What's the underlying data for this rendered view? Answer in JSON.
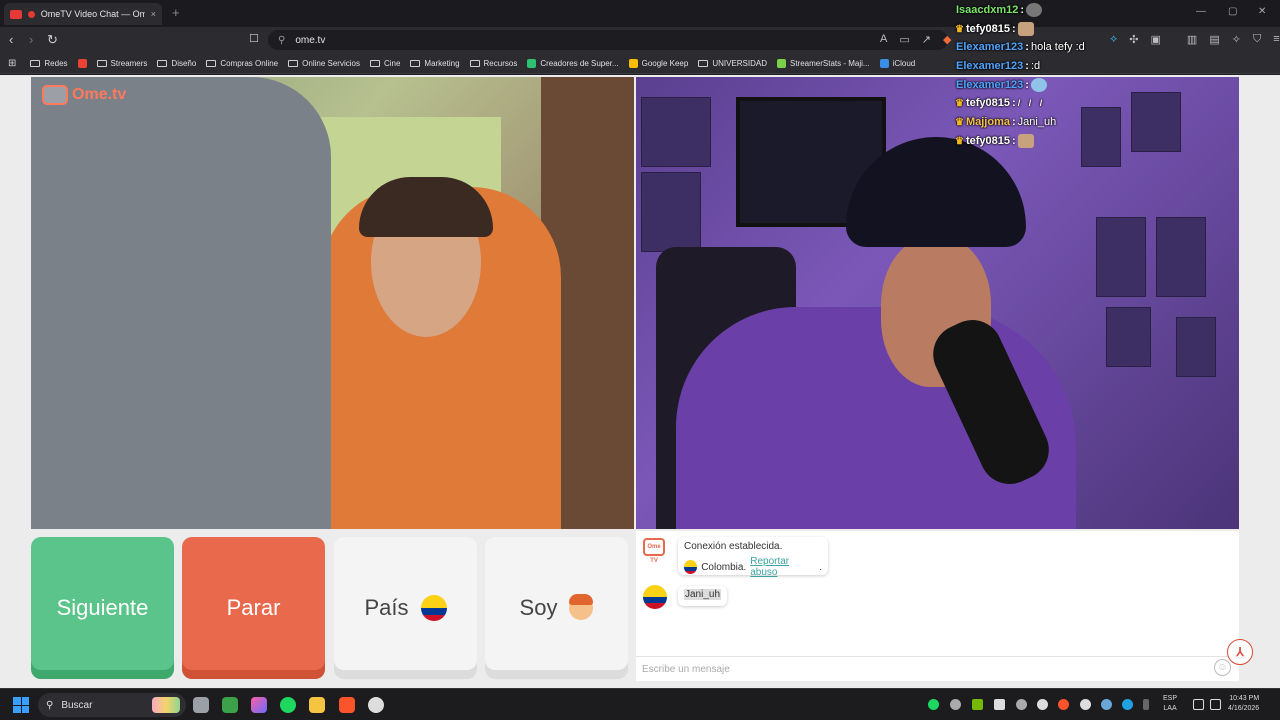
{
  "browser": {
    "tab_title": "OmeTV Video Chat — Omeg",
    "tab_close": "×",
    "new_tab": "+",
    "url": "ome.tv",
    "window_controls": [
      "—",
      "▢",
      "✕"
    ]
  },
  "bookmarks": [
    {
      "label": "Redes",
      "kind": "folder"
    },
    {
      "label": "",
      "kind": "gmail",
      "color": "#ea4335"
    },
    {
      "label": "Streamers",
      "kind": "folder"
    },
    {
      "label": "Diseño",
      "kind": "folder"
    },
    {
      "label": "Compras Online",
      "kind": "folder"
    },
    {
      "label": "Online Servicios",
      "kind": "folder"
    },
    {
      "label": "Cine",
      "kind": "folder"
    },
    {
      "label": "Marketing",
      "kind": "folder"
    },
    {
      "label": "Recursos",
      "kind": "folder"
    },
    {
      "label": "Creadores de Super...",
      "kind": "site",
      "color": "#2fbf71"
    },
    {
      "label": "Google Keep",
      "kind": "site",
      "color": "#fbbc04"
    },
    {
      "label": "UNIVERSIDAD",
      "kind": "folder"
    },
    {
      "label": "StreamerStats - Maji...",
      "kind": "site",
      "color": "#7cd14a"
    },
    {
      "label": "iCloud",
      "kind": "site",
      "color": "#3a8ee6"
    }
  ],
  "logo": {
    "text": "Ome.tv"
  },
  "buttons": {
    "next": "Siguiente",
    "stop": "Parar",
    "country": "País",
    "gender": "Soy"
  },
  "chat": {
    "system_icon_text": "Ome TV",
    "connected": "Conexión establecida.",
    "country": "Colombia.",
    "report": "Reportar abuso",
    "period": ".",
    "stranger_message": "Jani_uh",
    "placeholder": "Escribe un mensaje"
  },
  "stream_chat": [
    {
      "user": "Isaacdxm12",
      "color": "#7ee36b",
      "crown": false,
      "text": "",
      "emote": "grey"
    },
    {
      "user": "tefy0815",
      "color": "#ffffff",
      "crown": true,
      "text": "",
      "emote": "face"
    },
    {
      "user": "Elexamer123",
      "color": "#4fa3ff",
      "crown": false,
      "text": "hola tefy :d",
      "emote": ""
    },
    {
      "user": "Elexamer123",
      "color": "#4fa3ff",
      "crown": false,
      "text": ":d",
      "emote": ""
    },
    {
      "user": "Elexamer123",
      "color": "#4fa3ff",
      "crown": false,
      "text": "",
      "emote": "globe"
    },
    {
      "user": "tefy0815",
      "color": "#ffffff",
      "crown": true,
      "text": "",
      "emote": "sticks"
    },
    {
      "user": "Majjoma",
      "color": "#f3c04a",
      "crown": true,
      "text": "Jani_uh",
      "emote": ""
    },
    {
      "user": "tefy0815",
      "color": "#ffffff",
      "crown": true,
      "text": "",
      "emote": "face"
    }
  ],
  "taskbar": {
    "search": "Buscar",
    "lang_top": "ESP",
    "lang_bottom": "LAA",
    "time": "10:43 PM",
    "date": "4/16/2026"
  }
}
